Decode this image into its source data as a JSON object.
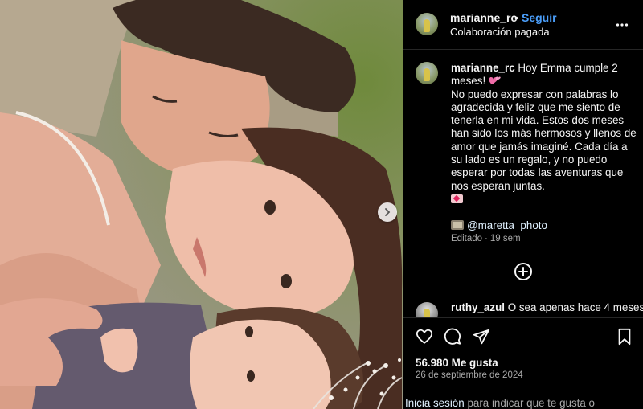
{
  "post": {
    "username": "marianne_rc",
    "dot": "•",
    "follow_label": "Seguir",
    "subtitle": "Colaboración pagada",
    "more_icon": "more-horizontal-icon"
  },
  "caption": {
    "username": "marianne_rc",
    "line1": "Hoy Emma cumple 2 meses!",
    "body": "No puedo expresar con palabras lo agradecida y feliz que me siento de tenerla en mi vida. Estos dos meses han sido los más hermosos y llenos de amor que jamás imaginé. Cada día a su lado es un regalo, y no puedo esperar por todas las aventuras que nos esperan juntas.",
    "photographer": "@maretta_photo",
    "edited": "Editado",
    "age": "19 sem"
  },
  "comment": {
    "username": "ruthy_azul",
    "text": "O sea apenas hace 4 meses"
  },
  "actions": {
    "likes": "56.980 Me gusta",
    "date": "26 de septiembre de 2024"
  },
  "login": {
    "link": "Inicia sesión",
    "text": "para indicar que te gusta o"
  },
  "colors": {
    "accent_blue": "#4a9df8",
    "background": "#000000",
    "muted": "#a8a8a8"
  }
}
